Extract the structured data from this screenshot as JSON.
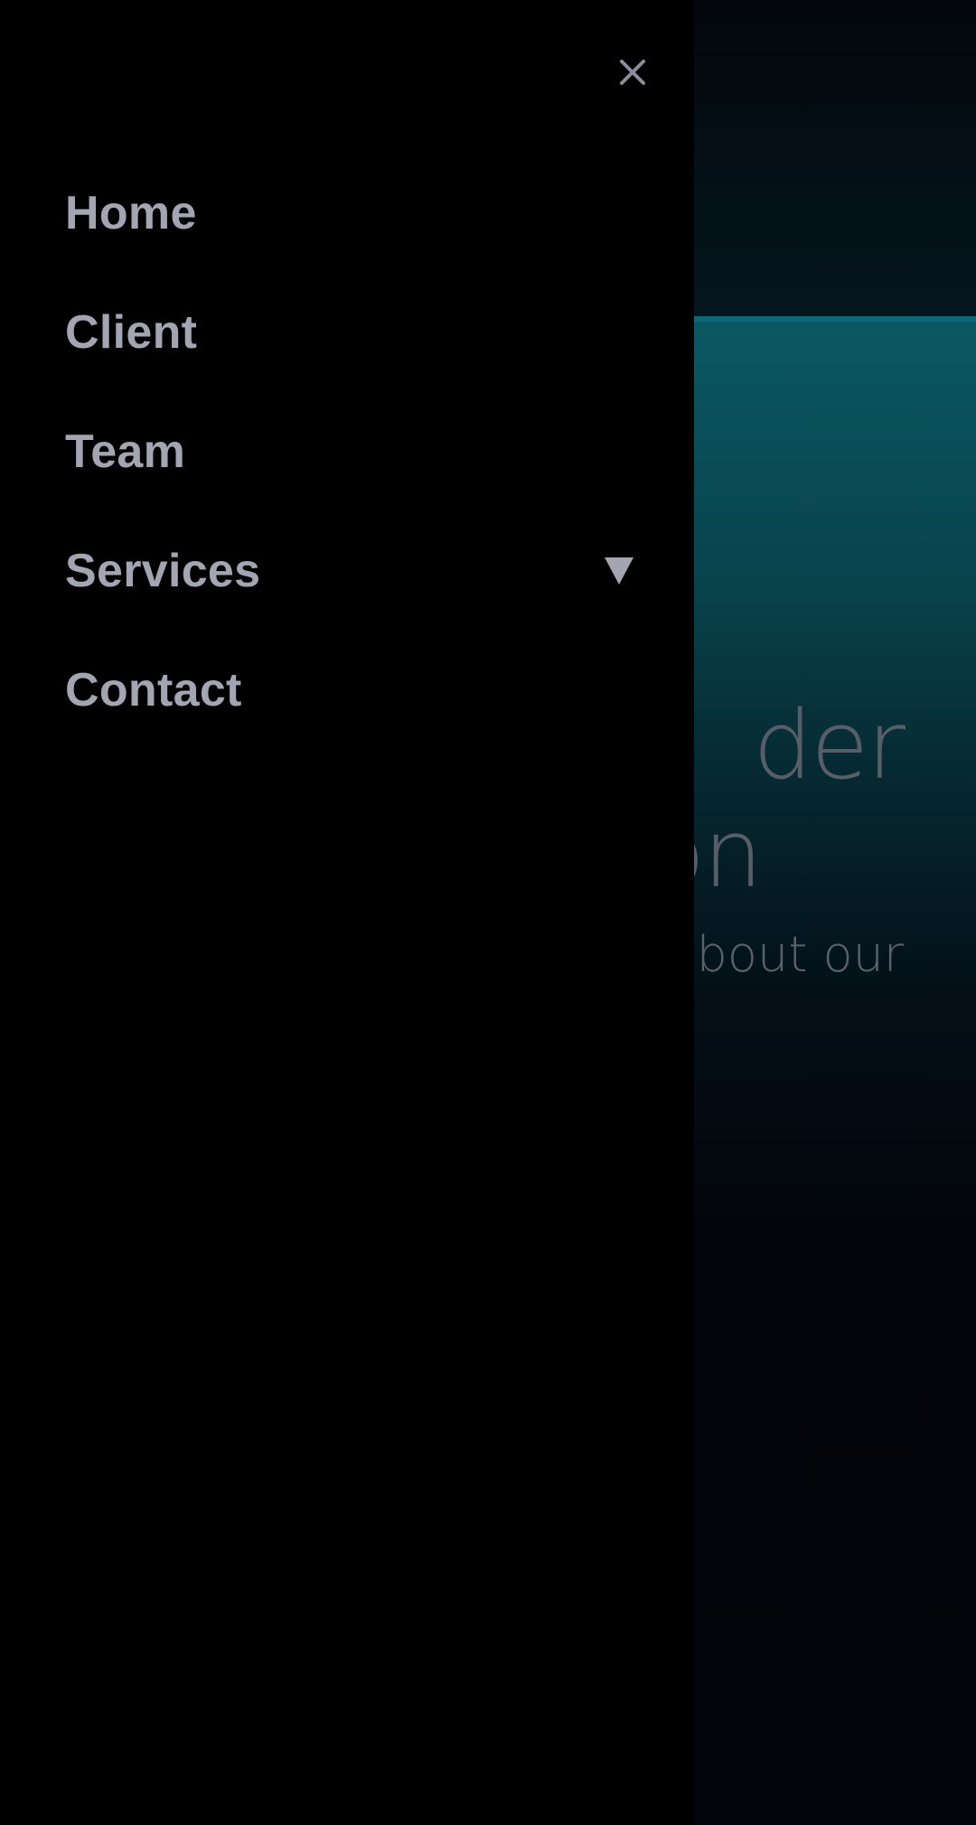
{
  "background": {
    "hero_title_line1": "der",
    "hero_title_line2": "on",
    "hero_subtitle": "about our"
  },
  "drawer": {
    "close_icon": "close-icon",
    "items": [
      {
        "label": "Home"
      },
      {
        "label": "Client"
      },
      {
        "label": "Team"
      },
      {
        "label": "Services",
        "has_submenu": true,
        "icon": "caret-down-icon"
      },
      {
        "label": "Contact"
      }
    ]
  },
  "colors": {
    "drawer_bg": "#000000",
    "nav_text": "#a3a6b2",
    "accent_teal": "#0b6a77",
    "overlay_text": "#5a616c"
  }
}
